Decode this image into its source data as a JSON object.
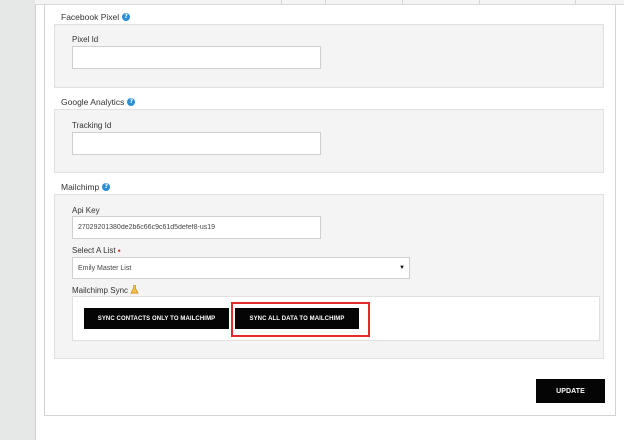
{
  "facebook_pixel": {
    "title": "Facebook Pixel",
    "help_icon": "?",
    "field_label": "Pixel Id",
    "field_value": ""
  },
  "google_analytics": {
    "title": "Google Analytics",
    "help_icon": "?",
    "field_label": "Tracking Id",
    "field_value": ""
  },
  "mailchimp": {
    "title": "Mailchimp",
    "help_icon": "?",
    "api_key_label": "Api Key",
    "api_key_value": "27029201380de2b6c66c9c61d5defef8-us19",
    "select_list_label": "Select A List",
    "required_marker": "•",
    "select_list_value": "Emily Master List",
    "sync_label": "Mailchimp Sync",
    "sync_contacts_button": "SYNC CONTACTS ONLY TO MAILCHIMP",
    "sync_all_button": "SYNC ALL DATA TO MAILCHIMP"
  },
  "footer": {
    "update_button": "UPDATE"
  },
  "colors": {
    "help_icon": "#2c8fd8",
    "highlight_border": "#e52b2b",
    "button_bg": "#050505",
    "required": "#e53935",
    "warning_icon": "#e2a628"
  },
  "icons": {
    "help": "question-circle-icon",
    "sync_warning": "flask-icon",
    "select_caret": "caret-down-icon"
  }
}
